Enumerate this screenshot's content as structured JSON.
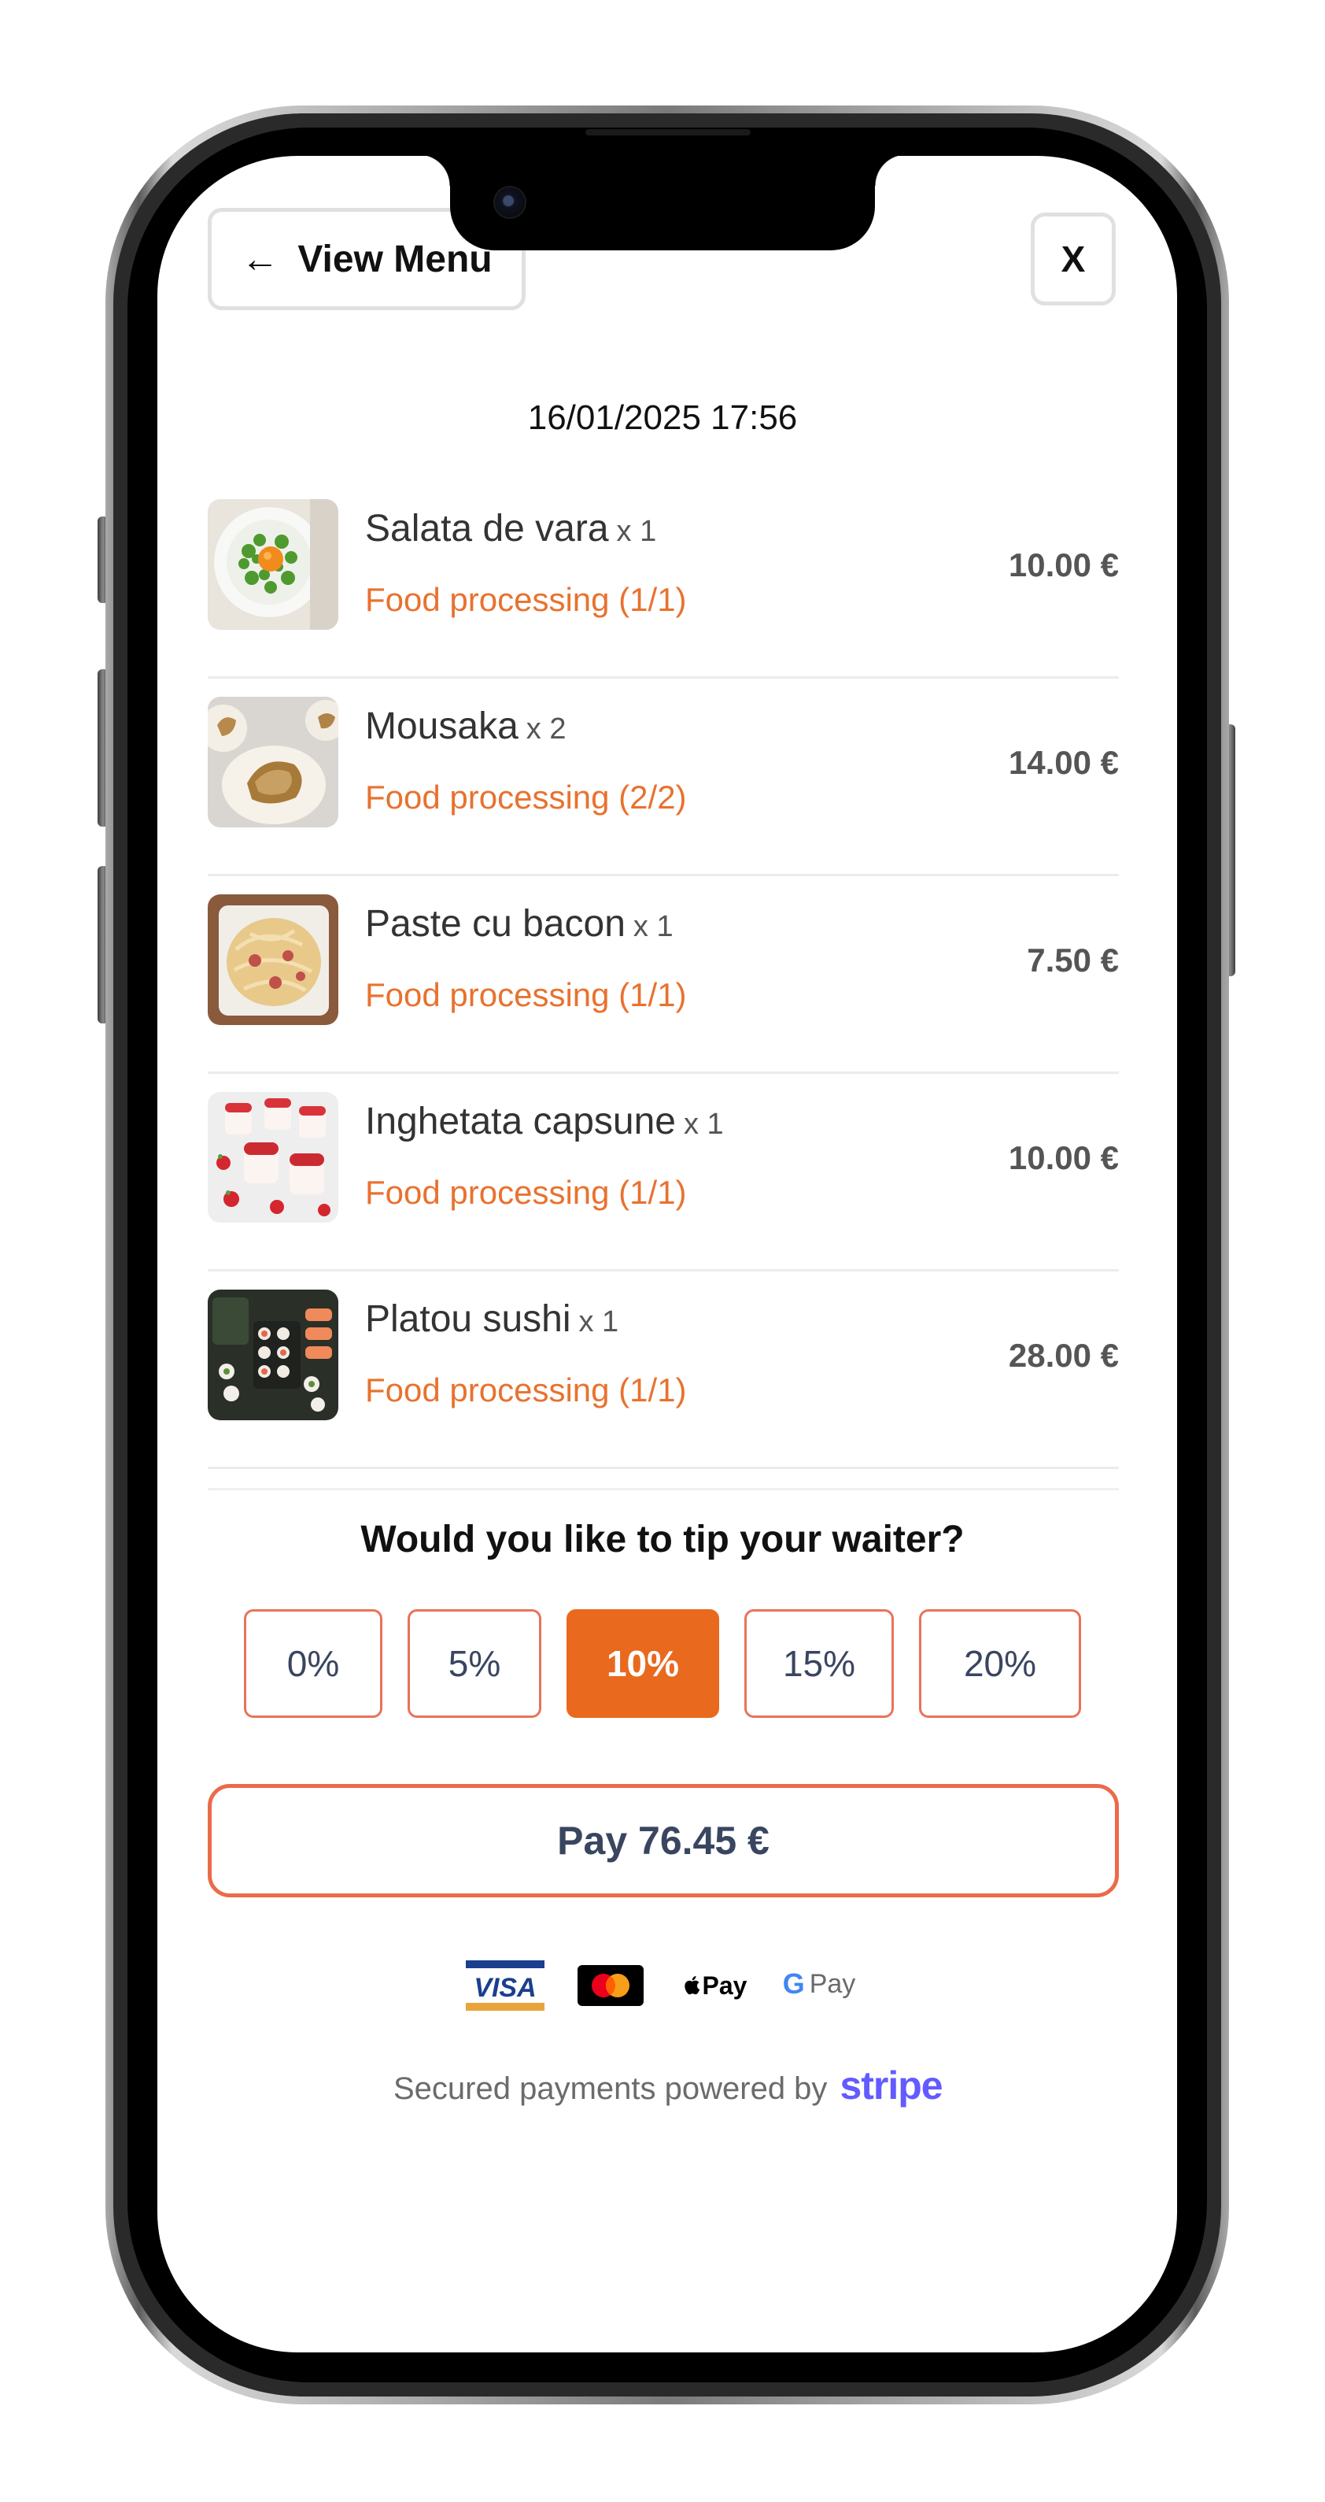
{
  "header": {
    "back_arrow": "←",
    "back_label": "View Menu",
    "close_label": "X"
  },
  "order": {
    "timestamp": "16/01/2025 17:56",
    "items": [
      {
        "name": "Salata de vara",
        "qty": "x 1",
        "status": "Food processing (1/1)",
        "price": "10.00 €"
      },
      {
        "name": "Mousaka",
        "qty": "x 2",
        "status": "Food processing (2/2)",
        "price": "14.00 €"
      },
      {
        "name": "Paste cu bacon",
        "qty": "x 1",
        "status": "Food processing (1/1)",
        "price": "7.50 €"
      },
      {
        "name": "Inghetata capsune",
        "qty": "x 1",
        "status": "Food processing (1/1)",
        "price": "10.00 €"
      },
      {
        "name": "Platou sushi",
        "qty": "x 1",
        "status": "Food processing (1/1)",
        "price": "28.00 €"
      }
    ]
  },
  "tip": {
    "question": "Would you like to tip your waiter?",
    "options": [
      "0%",
      "5%",
      "10%",
      "15%",
      "20%"
    ],
    "selected": "10%"
  },
  "pay": {
    "label": "Pay 76.45 €"
  },
  "payment_logos": {
    "visa": "VISA",
    "apple_pay": "Pay",
    "google_pay": "Pay",
    "google_g": "G"
  },
  "footer": {
    "secured_text": "Secured payments powered by",
    "provider": "stripe"
  },
  "colors": {
    "accent": "#e9691e",
    "status": "#e8722f",
    "stripe": "#635bff",
    "text_dark": "#3a4560"
  }
}
